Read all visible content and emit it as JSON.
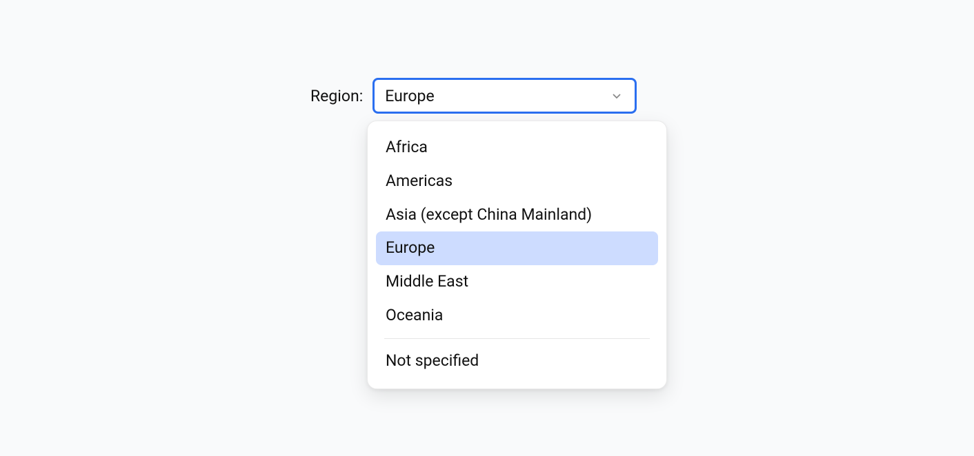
{
  "form": {
    "label": "Region:",
    "selected_value": "Europe"
  },
  "dropdown": {
    "options": [
      "Africa",
      "Americas",
      "Asia (except China Mainland)",
      "Europe",
      "Middle East",
      "Oceania"
    ],
    "fallback_option": "Not specified",
    "selected_index": 3
  }
}
